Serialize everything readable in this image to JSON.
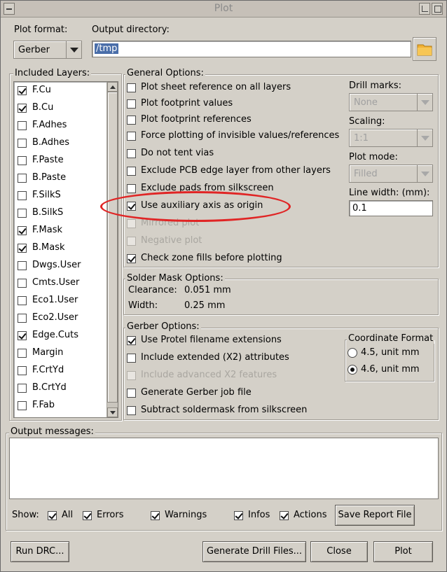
{
  "window": {
    "title": "Plot"
  },
  "top": {
    "plot_format_label": "Plot format:",
    "plot_format_value": "Gerber",
    "output_dir_label": "Output directory:",
    "output_dir_value": "/tmp"
  },
  "layers": {
    "title": "Included Layers:",
    "items": [
      {
        "label": "F.Cu",
        "checked": true
      },
      {
        "label": "B.Cu",
        "checked": true
      },
      {
        "label": "F.Adhes",
        "checked": false
      },
      {
        "label": "B.Adhes",
        "checked": false
      },
      {
        "label": "F.Paste",
        "checked": false
      },
      {
        "label": "B.Paste",
        "checked": false
      },
      {
        "label": "F.SilkS",
        "checked": false
      },
      {
        "label": "B.SilkS",
        "checked": false
      },
      {
        "label": "F.Mask",
        "checked": true
      },
      {
        "label": "B.Mask",
        "checked": true
      },
      {
        "label": "Dwgs.User",
        "checked": false
      },
      {
        "label": "Cmts.User",
        "checked": false
      },
      {
        "label": "Eco1.User",
        "checked": false
      },
      {
        "label": "Eco2.User",
        "checked": false
      },
      {
        "label": "Edge.Cuts",
        "checked": true
      },
      {
        "label": "Margin",
        "checked": false
      },
      {
        "label": "F.CrtYd",
        "checked": false
      },
      {
        "label": "B.CrtYd",
        "checked": false
      },
      {
        "label": "F.Fab",
        "checked": false
      }
    ]
  },
  "general": {
    "title": "General Options:",
    "options": [
      {
        "label": "Plot sheet reference on all layers",
        "checked": false,
        "disabled": false
      },
      {
        "label": "Plot footprint values",
        "checked": false,
        "disabled": false
      },
      {
        "label": "Plot footprint references",
        "checked": false,
        "disabled": false
      },
      {
        "label": "Force plotting of invisible values/references",
        "checked": false,
        "disabled": false
      },
      {
        "label": "Do not tent vias",
        "checked": false,
        "disabled": false
      },
      {
        "label": "Exclude PCB edge layer from other layers",
        "checked": false,
        "disabled": false
      },
      {
        "label": "Exclude pads from silkscreen",
        "checked": false,
        "disabled": false
      },
      {
        "label": "Use auxiliary axis as origin",
        "checked": true,
        "disabled": false
      },
      {
        "label": "Mirrored plot",
        "checked": false,
        "disabled": true
      },
      {
        "label": "Negative plot",
        "checked": false,
        "disabled": true
      },
      {
        "label": "Check zone fills before plotting",
        "checked": true,
        "disabled": false
      }
    ],
    "drill_marks_label": "Drill marks:",
    "drill_marks_value": "None",
    "scaling_label": "Scaling:",
    "scaling_value": "1:1",
    "plot_mode_label": "Plot mode:",
    "plot_mode_value": "Filled",
    "line_width_label": "Line width: (mm):",
    "line_width_value": "0.1"
  },
  "solder_mask": {
    "title": "Solder Mask Options:",
    "clearance_label": "Clearance:",
    "clearance_value": "0.051 mm",
    "width_label": "Width:",
    "width_value": "0.25 mm"
  },
  "gerber": {
    "title": "Gerber Options:",
    "options": [
      {
        "label": "Use Protel filename extensions",
        "checked": true,
        "disabled": false
      },
      {
        "label": "Include extended (X2) attributes",
        "checked": false,
        "disabled": false
      },
      {
        "label": "Include advanced X2 features",
        "checked": false,
        "disabled": true
      },
      {
        "label": "Generate Gerber job file",
        "checked": false,
        "disabled": false
      },
      {
        "label": "Subtract soldermask from silkscreen",
        "checked": false,
        "disabled": false
      }
    ],
    "coord_title": "Coordinate Format",
    "coord_options": [
      {
        "label": "4.5, unit mm",
        "checked": false
      },
      {
        "label": "4.6, unit mm",
        "checked": true
      }
    ]
  },
  "messages": {
    "title": "Output messages:",
    "show_label": "Show:",
    "filters": [
      {
        "label": "All",
        "checked": true
      },
      {
        "label": "Errors",
        "checked": true
      },
      {
        "label": "Warnings",
        "checked": true
      },
      {
        "label": "Infos",
        "checked": true
      },
      {
        "label": "Actions",
        "checked": true
      }
    ],
    "save_report": "Save Report File"
  },
  "buttons": {
    "run_drc": "Run DRC...",
    "generate_drill": "Generate Drill Files...",
    "close": "Close",
    "plot": "Plot"
  },
  "colors": {
    "annotation": "#e02525",
    "folder": "#f2b134"
  }
}
